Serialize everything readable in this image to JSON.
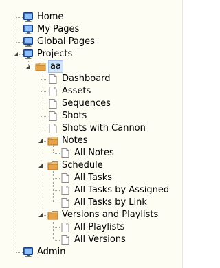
{
  "tree": {
    "home": {
      "label": "Home"
    },
    "my_pages": {
      "label": "My Pages"
    },
    "global_pages": {
      "label": "Global Pages"
    },
    "projects": {
      "label": "Projects",
      "aa": {
        "label": "aa",
        "dashboard": {
          "label": "Dashboard"
        },
        "assets": {
          "label": "Assets"
        },
        "sequences": {
          "label": "Sequences"
        },
        "shots": {
          "label": "Shots"
        },
        "shots_with_cannon": {
          "label": "Shots with Cannon"
        },
        "notes": {
          "label": "Notes",
          "all_notes": {
            "label": "All Notes"
          }
        },
        "schedule": {
          "label": "Schedule",
          "all_tasks": {
            "label": "All Tasks"
          },
          "all_tasks_by_assigned": {
            "label": "All Tasks by Assigned"
          },
          "all_tasks_by_link": {
            "label": "All Tasks by Link"
          }
        },
        "versions_and_playlists": {
          "label": "Versions and Playlists",
          "all_playlists": {
            "label": "All Playlists"
          },
          "all_versions": {
            "label": "All Versions"
          }
        }
      }
    },
    "admin": {
      "label": "Admin"
    }
  },
  "icons": {
    "page_node": "monitor-icon",
    "folder_node": "folder-icon",
    "leaf_node": "document-icon"
  },
  "colors": {
    "panel_background": "#fdfdf3",
    "selection_fill": "#cfe3fb",
    "selection_border": "#9cc2f2",
    "tree_line": "#a0a0a0",
    "monitor_blue": "#2f6fc7",
    "folder_orange": "#e6a34a"
  }
}
